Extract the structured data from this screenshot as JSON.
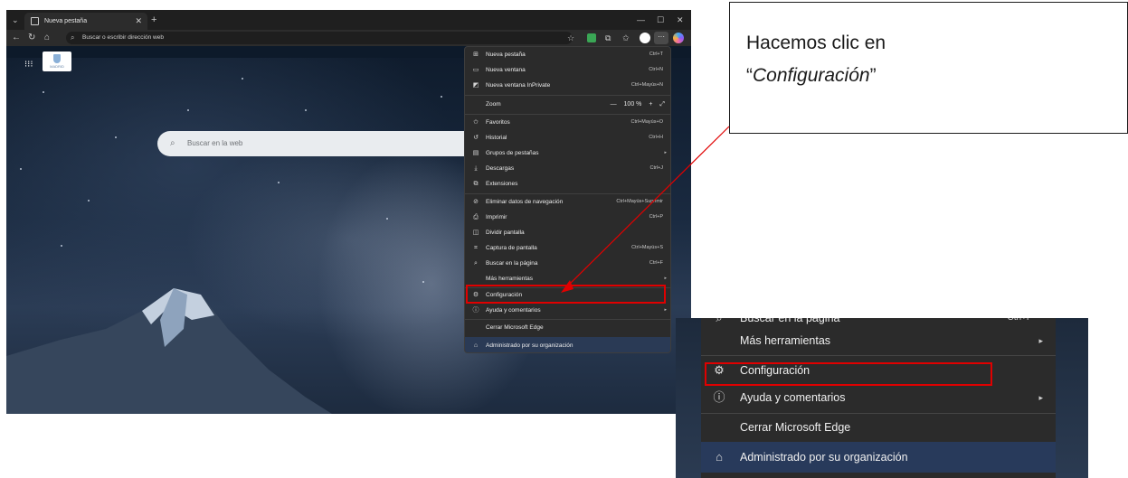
{
  "browser": {
    "tab_title": "Nueva pestaña",
    "new_tab_symbol": "+",
    "address_placeholder": "Buscar o escribir dirección web",
    "window_minimize": "—",
    "window_maximize": "☐",
    "window_close": "✕",
    "org_logo_text": "MADRID",
    "page_search_placeholder": "Buscar en la web"
  },
  "menu": {
    "items": [
      {
        "label": "Nueva pestaña",
        "shortcut": "Ctrl+T",
        "icon": "new-tab-icon"
      },
      {
        "label": "Nueva ventana",
        "shortcut": "Ctrl+N",
        "icon": "new-window-icon"
      },
      {
        "label": "Nueva ventana InPrivate",
        "shortcut": "Ctrl+Mayús+N",
        "icon": "inprivate-icon"
      },
      {
        "label": "Zoom",
        "zoom_value": "100 %",
        "minus": "—",
        "plus": "+",
        "expand": "⤢"
      },
      {
        "label": "Favoritos",
        "shortcut": "Ctrl+Mayús+O",
        "icon": "favorites-icon"
      },
      {
        "label": "Historial",
        "shortcut": "Ctrl+H",
        "icon": "history-icon"
      },
      {
        "label": "Grupos de pestañas",
        "shortcut": "",
        "icon": "tab-groups-icon"
      },
      {
        "label": "Descargas",
        "shortcut": "Ctrl+J",
        "icon": "downloads-icon"
      },
      {
        "label": "Extensiones",
        "shortcut": "",
        "icon": "extensions-icon"
      },
      {
        "label": "Eliminar datos de navegación",
        "shortcut": "Ctrl+Mayús+Suprimir",
        "icon": "delete-data-icon"
      },
      {
        "label": "Imprimir",
        "shortcut": "Ctrl+P",
        "icon": "print-icon"
      },
      {
        "label": "Dividir pantalla",
        "shortcut": "",
        "icon": "split-screen-icon"
      },
      {
        "label": "Captura de pantalla",
        "shortcut": "Ctrl+Mayús+S",
        "icon": "screenshot-icon"
      },
      {
        "label": "Buscar en la página",
        "shortcut": "Ctrl+F",
        "icon": "find-icon"
      },
      {
        "label": "Más herramientas",
        "shortcut": "",
        "icon": ""
      },
      {
        "label": "Configuración",
        "shortcut": "",
        "icon": "gear-icon"
      },
      {
        "label": "Ayuda y comentarios",
        "shortcut": "",
        "icon": "help-icon"
      },
      {
        "label": "Cerrar Microsoft Edge",
        "shortcut": "",
        "icon": ""
      },
      {
        "label": "Administrado por su organización",
        "shortcut": "",
        "icon": "briefcase-icon"
      }
    ]
  },
  "callout": {
    "line1": "Hacemos clic en",
    "open_quote": "“",
    "emphasis": "Configuración",
    "close_quote": "”"
  },
  "zoom_detail": {
    "find_label": "Buscar en la página",
    "find_shortcut": "Ctrl+F",
    "more_tools": "Más herramientas",
    "settings": "Configuración",
    "help": "Ayuda y comentarios",
    "close_edge": "Cerrar Microsoft Edge",
    "managed": "Administrado por su organización"
  },
  "colors": {
    "highlight": "#e00000",
    "menu_bg": "#2b2b2b",
    "org_bar": "#2a3a55",
    "search_box": "#e9ecef"
  }
}
